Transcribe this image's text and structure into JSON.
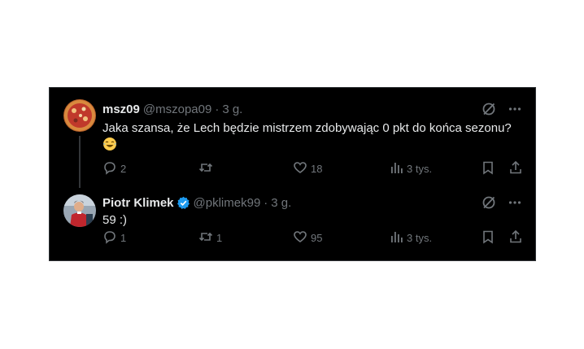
{
  "colors": {
    "background": "#000000",
    "border": "#2f3336",
    "text_primary": "#e7e9ea",
    "text_secondary": "#71767b",
    "verified_blue": "#1d9bf0"
  },
  "tweets": [
    {
      "display_name": "msz09",
      "handle": "@mszopa09",
      "separator": "·",
      "time": "3 g.",
      "text": "Jaka szansa, że Lech będzie mistrzem zdobywając 0 pkt do końca sezonu?",
      "emoji": "face-with-tears-of-joy",
      "actions": {
        "reply_count": "2",
        "retweet_count": "",
        "like_count": "18",
        "views_count": "3 tys."
      },
      "icons": [
        "grok-icon",
        "more-icon",
        "reply-icon",
        "retweet-icon",
        "like-icon",
        "views-icon",
        "bookmark-icon",
        "share-icon"
      ]
    },
    {
      "display_name": "Piotr Klimek",
      "verified": true,
      "handle": "@pklimek99",
      "separator": "·",
      "time": "3 g.",
      "text": "59 :)",
      "actions": {
        "reply_count": "1",
        "retweet_count": "1",
        "like_count": "95",
        "views_count": "3 tys."
      },
      "icons": [
        "grok-icon",
        "more-icon",
        "reply-icon",
        "retweet-icon",
        "like-icon",
        "views-icon",
        "bookmark-icon",
        "share-icon"
      ]
    }
  ]
}
